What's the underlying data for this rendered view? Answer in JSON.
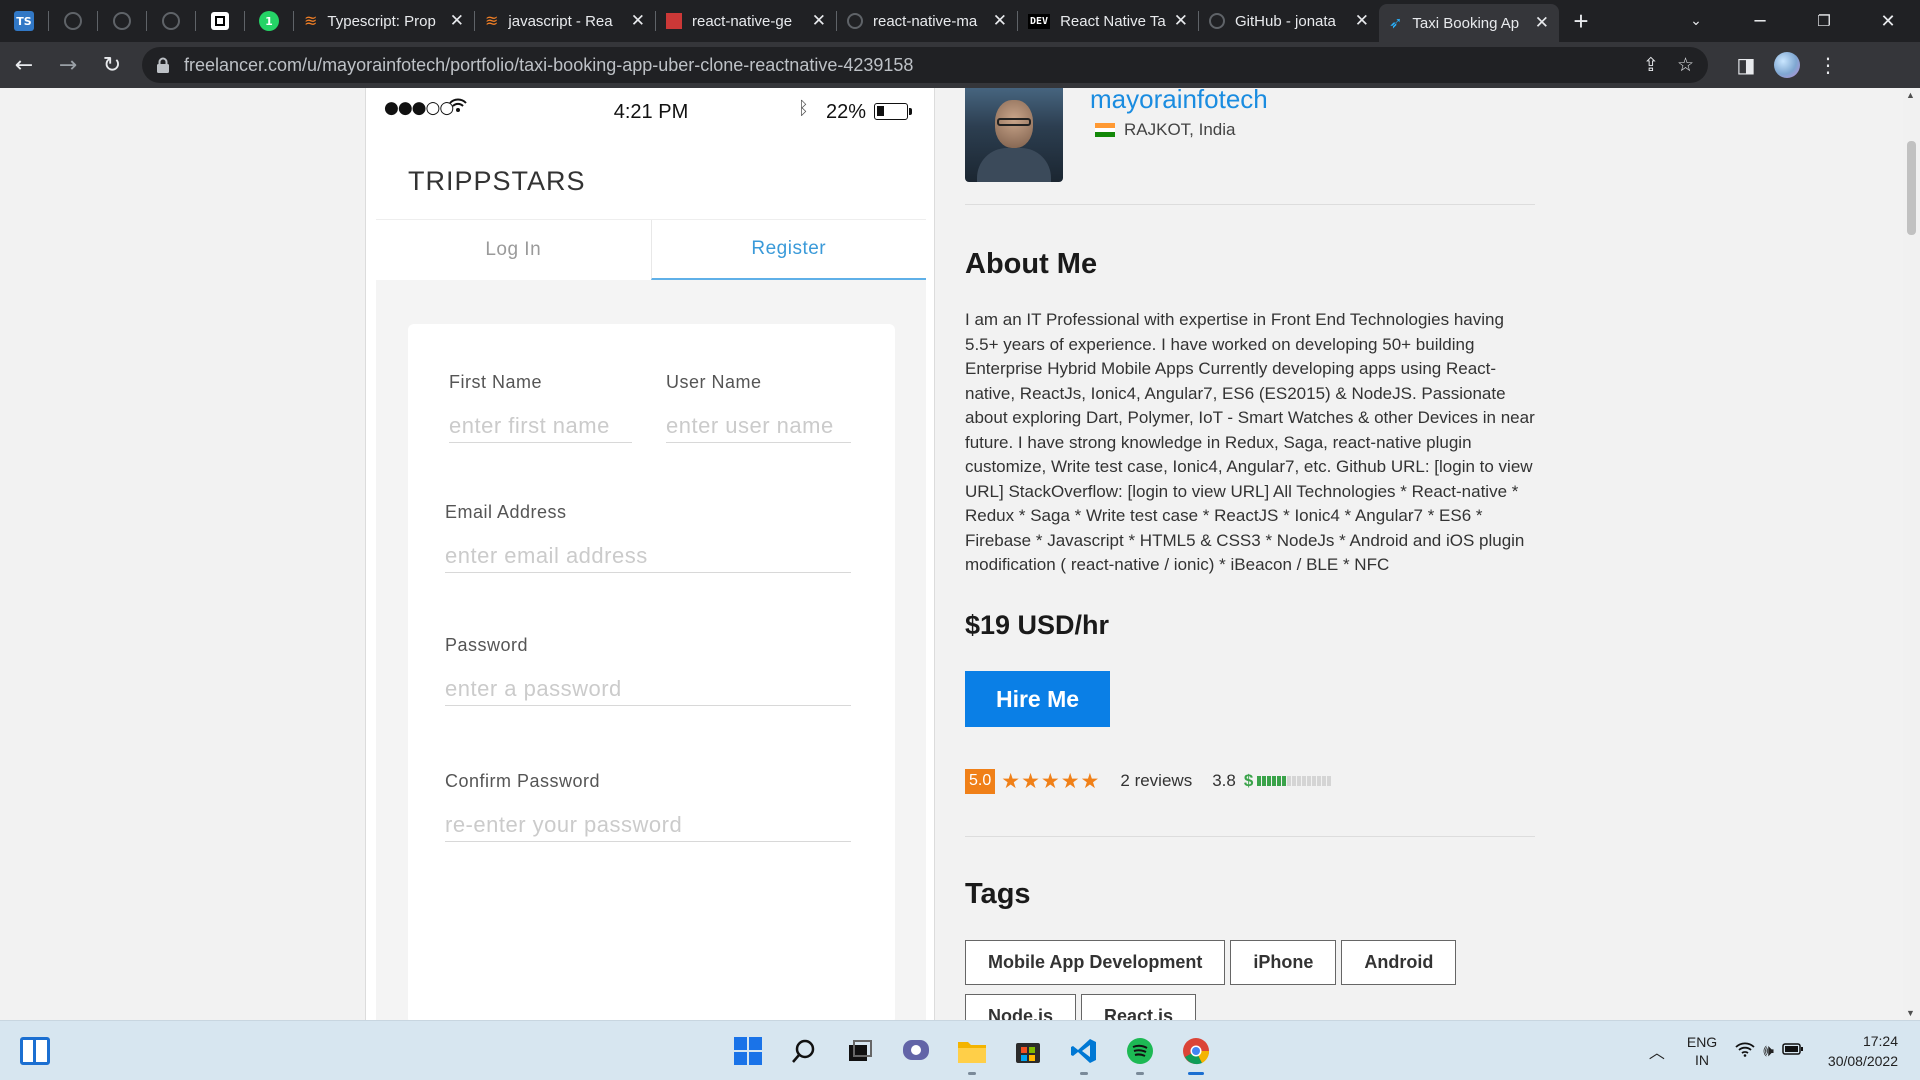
{
  "browser": {
    "pinned_tabs": [
      {
        "icon": "typescript-icon",
        "text": "TS",
        "color": "#3178c6"
      },
      {
        "icon": "github-icon",
        "text": "",
        "color": "#202124"
      },
      {
        "icon": "github-icon",
        "text": "",
        "color": "#202124"
      },
      {
        "icon": "github-icon",
        "text": "",
        "color": "#202124"
      },
      {
        "icon": "app-icon",
        "text": "",
        "color": "#000000"
      },
      {
        "icon": "whatsapp-icon",
        "text": "1",
        "color": "#25d366"
      }
    ],
    "tabs": [
      {
        "title": "Typescript: Prop",
        "icon": "stackoverflow-icon"
      },
      {
        "title": "javascript - Rea",
        "icon": "stackoverflow-icon"
      },
      {
        "title": "react-native-ge",
        "icon": "npm-icon"
      },
      {
        "title": "react-native-ma",
        "icon": "github-icon"
      },
      {
        "title": "React Native Ta",
        "icon": "dev-icon"
      },
      {
        "title": "GitHub - jonata",
        "icon": "github-icon"
      },
      {
        "title": "Taxi Booking Ap",
        "icon": "freelancer-icon",
        "active": true
      }
    ],
    "url": "freelancer.com/u/mayorainfotech/portfolio/taxi-booking-app-uber-clone-reactnative-4239158"
  },
  "phone": {
    "status": {
      "time": "4:21 PM",
      "battery": "22%"
    },
    "brand": "TRIPPSTARS",
    "tabs": {
      "login": "Log In",
      "register": "Register"
    },
    "fields": {
      "first_name": {
        "label": "First Name",
        "placeholder": "enter first name"
      },
      "user_name": {
        "label": "User Name",
        "placeholder": "enter user name"
      },
      "email": {
        "label": "Email Address",
        "placeholder": "enter email address"
      },
      "password": {
        "label": "Password",
        "placeholder": "enter a password"
      },
      "confirm": {
        "label": "Confirm Password",
        "placeholder": "re-enter your password"
      }
    }
  },
  "profile": {
    "username": "mayorainfotech",
    "location": "RAJKOT, India",
    "about_heading": "About Me",
    "about_text": "I am an IT Professional with expertise in Front End Technologies having 5.5+ years of experience. I have worked on developing 50+ building Enterprise Hybrid Mobile Apps Currently developing apps using React-native, ReactJs, Ionic4, Angular7, ES6 (ES2015) & NodeJS. Passionate about exploring Dart, Polymer, IoT - Smart Watches & other Devices in near future. I have strong knowledge in Redux, Saga, react-native plugin customize, Write test case, Ionic4, Angular7, etc. Github URL: [login to view URL] StackOverflow: [login to view URL] All Technologies * React-native * Redux * Saga * Write test case * ReactJS * Ionic4 * Angular7 * ES6 * Firebase * Javascript * HTML5 & CSS3 * NodeJs * Android and iOS plugin modification ( react-native / ionic) * iBeacon / BLE * NFC",
    "rate": "$19 USD/hr",
    "hire_label": "Hire Me",
    "rating_score": "5.0",
    "stars": "★★★★★",
    "reviews": "2 reviews",
    "earnings_score": "3.8",
    "earnings_level": 0.38,
    "tags_heading": "Tags",
    "tags": [
      "Mobile App Development",
      "iPhone",
      "Android",
      "Node.js",
      "React.js"
    ]
  },
  "taskbar": {
    "apps": [
      "windows-start-icon",
      "search-icon",
      "task-view-icon",
      "chat-icon",
      "file-explorer-icon",
      "store-icon",
      "vscode-icon",
      "spotify-icon",
      "chrome-icon"
    ],
    "lang_line1": "ENG",
    "lang_line2": "IN",
    "time": "17:24",
    "date": "30/08/2022"
  }
}
